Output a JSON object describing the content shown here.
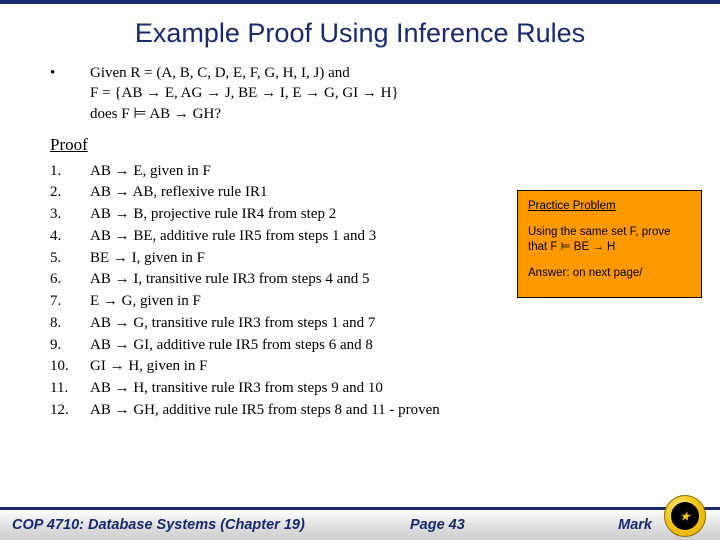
{
  "title": "Example Proof Using Inference Rules",
  "given": {
    "bullet": "•",
    "line1": "Given R = (A, B, C, D, E, F, G, H, I, J) and",
    "line2": "F = {AB → E, AG → J, BE → I, E → G, GI → H}",
    "line3": "does F ⊨ AB → GH?"
  },
  "proof_label": "Proof",
  "steps": [
    {
      "n": "1.",
      "t": "AB → E, given in F"
    },
    {
      "n": "2.",
      "t": "AB → AB, reflexive rule IR1"
    },
    {
      "n": "3.",
      "t": "AB → B, projective rule IR4 from step 2"
    },
    {
      "n": "4.",
      "t": "AB → BE, additive rule IR5 from steps 1 and 3"
    },
    {
      "n": "5.",
      "t": "BE → I, given in F"
    },
    {
      "n": "6.",
      "t": "AB → I, transitive rule IR3 from steps 4 and 5"
    },
    {
      "n": "7.",
      "t": "E → G, given in F"
    },
    {
      "n": "8.",
      "t": "AB → G, transitive rule IR3 from steps 1 and 7"
    },
    {
      "n": "9.",
      "t": "AB → GI, additive rule IR5 from steps 6 and 8"
    },
    {
      "n": "10.",
      "t": "GI → H, given in F"
    },
    {
      "n": "11.",
      "t": "AB → H, transitive rule IR3 from steps 9 and 10"
    },
    {
      "n": "12.",
      "t": "AB → GH, additive rule IR5 from steps 8 and 11 - proven"
    }
  ],
  "practice": {
    "title": "Practice Problem",
    "body": "Using the same set F, prove that F ⊨ BE → H",
    "answer": "Answer: on next page/"
  },
  "footer": {
    "course": "COP 4710: Database Systems  (Chapter 19)",
    "page": "Page 43",
    "author": "Mark"
  }
}
